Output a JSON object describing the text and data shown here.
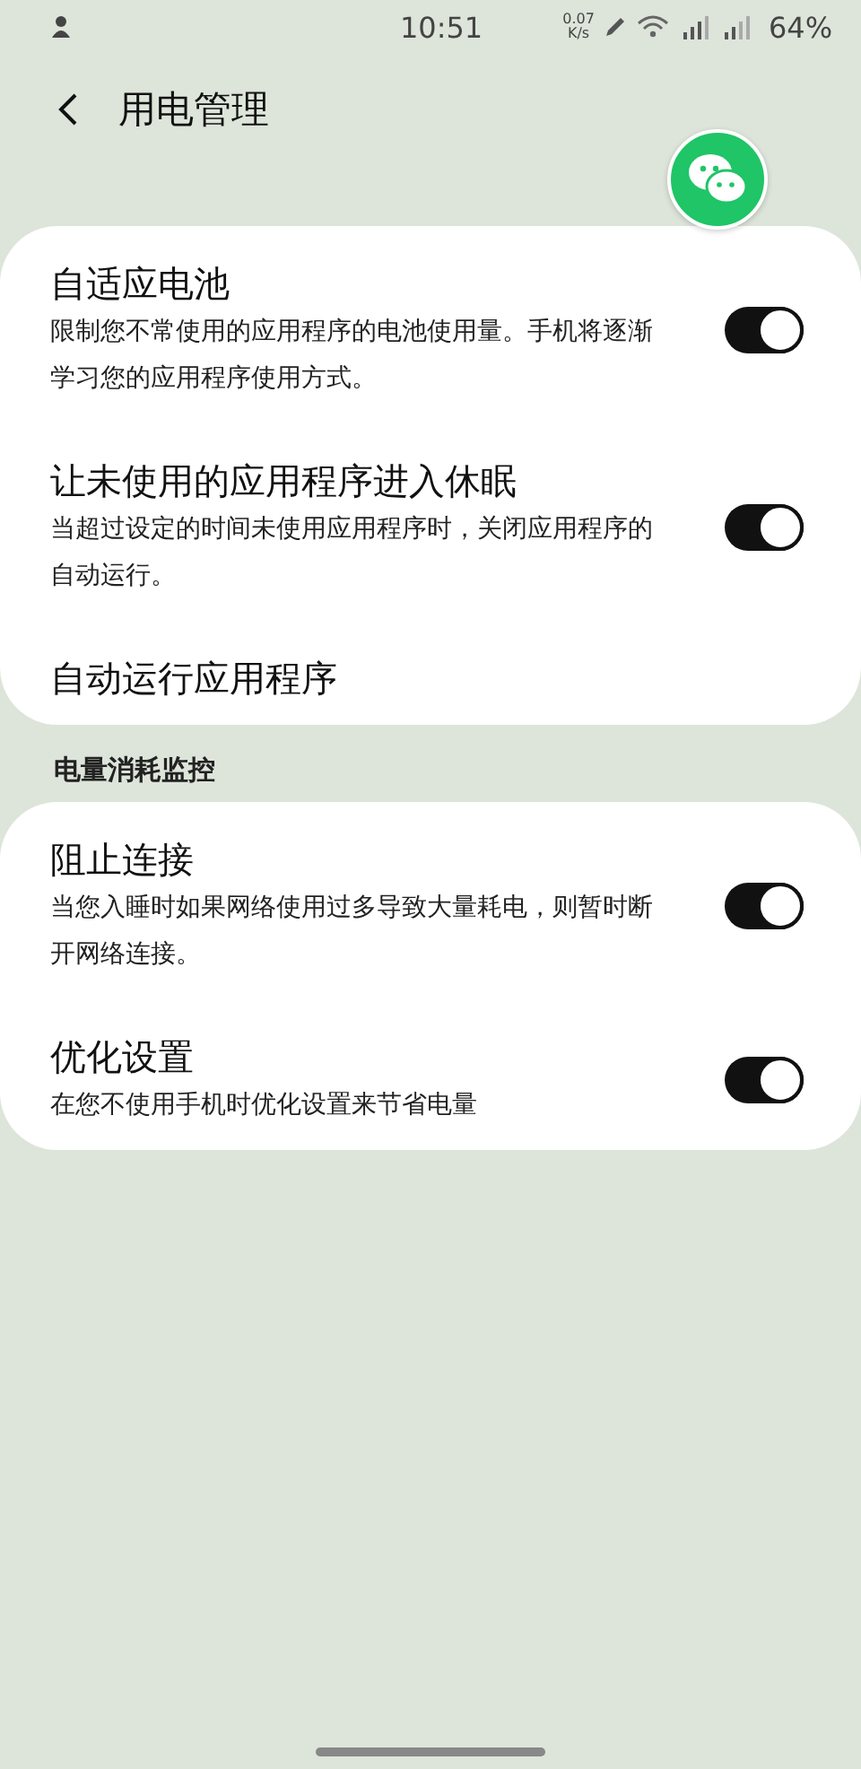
{
  "status_bar": {
    "time": "10:51",
    "net_speed": "0.07",
    "net_unit": "K/s",
    "battery": "64%"
  },
  "header": {
    "title": "用电管理"
  },
  "sections": [
    {
      "items": [
        {
          "kind": "switch",
          "title": "自适应电池",
          "description": "限制您不常使用的应用程序的电池使用量。手机将逐渐学习您的应用程序使用方式。",
          "on": true
        },
        {
          "kind": "switch",
          "title": "让未使用的应用程序进入休眠",
          "description": "当超过设定的时间未使用应用程序时，关闭应用程序的自动运行。",
          "on": true
        },
        {
          "kind": "link",
          "title": "自动运行应用程序"
        }
      ]
    },
    {
      "heading": "电量消耗监控",
      "items": [
        {
          "kind": "switch",
          "title": "阻止连接",
          "description": "当您入睡时如果网络使用过多导致大量耗电，则暂时断开网络连接。",
          "on": true
        },
        {
          "kind": "switch",
          "title": "优化设置",
          "description": "在您不使用手机时优化设置来节省电量",
          "on": true
        }
      ]
    }
  ]
}
